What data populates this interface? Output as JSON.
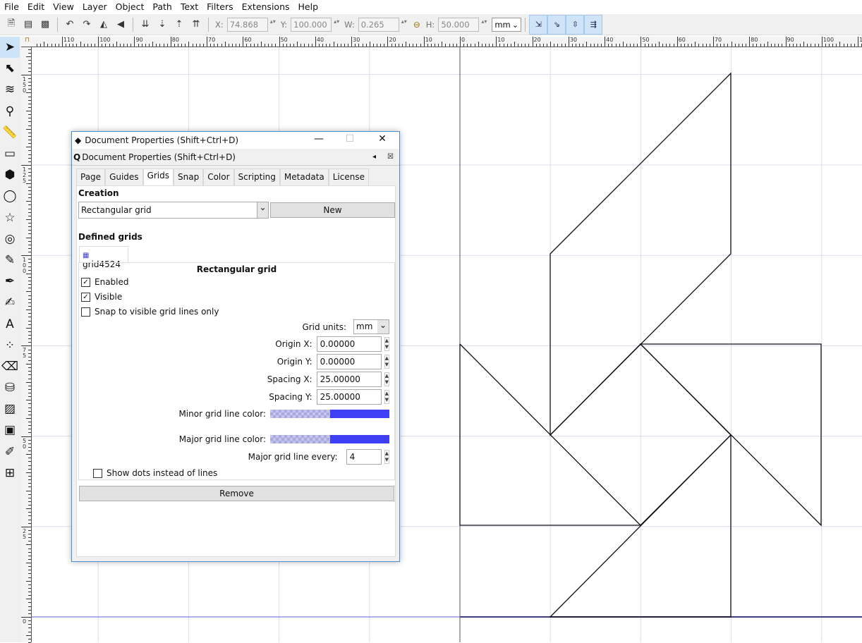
{
  "menu": [
    "File",
    "Edit",
    "View",
    "Layer",
    "Object",
    "Path",
    "Text",
    "Filters",
    "Extensions",
    "Help"
  ],
  "toolbar": {
    "x_label": "X:",
    "x": "74.868",
    "y_label": "Y:",
    "y": "100.000",
    "w_label": "W:",
    "w": "0.265",
    "h_label": "H:",
    "h": "50.000",
    "units": "mm",
    "icons": [
      "new-doc-icon",
      "select-all-icon",
      "select-all-layers-icon",
      "rotate-ccw-icon",
      "rotate-cw-icon",
      "flip-h-icon",
      "flip-v-icon",
      "lower-bottom-icon",
      "lower-icon",
      "raise-icon",
      "raise-top-icon"
    ]
  },
  "toolbox": [
    "selector",
    "node",
    "tweak",
    "zoom",
    "measure",
    "rectangle",
    "3d-box",
    "ellipse",
    "star",
    "spiral",
    "pencil",
    "pen",
    "calligraphy",
    "text",
    "spray",
    "eraser",
    "bucket",
    "gradient",
    "mesh",
    "dropper",
    "connector"
  ],
  "rulers": {
    "h_left": [
      "110",
      "100",
      "90",
      "80",
      "70",
      "60",
      "50",
      "40",
      "30",
      "20",
      "10"
    ],
    "h_right": [
      "0",
      "10",
      "20",
      "30",
      "40",
      "50",
      "60",
      "70",
      "80",
      "90",
      "100",
      "110"
    ],
    "v": [
      "150",
      "125",
      "100",
      "75",
      "50",
      "25",
      "0"
    ]
  },
  "dialog": {
    "window_title": "Document Properties (Shift+Ctrl+D)",
    "dock_title": "Document Properties (Shift+Ctrl+D)",
    "tabs": [
      "Page",
      "Guides",
      "Grids",
      "Snap",
      "Color",
      "Scripting",
      "Metadata",
      "License"
    ],
    "active_tab": "Grids",
    "creation_label": "Creation",
    "grid_type": "Rectangular grid",
    "new_label": "New",
    "defined_label": "Defined grids",
    "grid_tab": "grid4524",
    "section_title": "Rectangular grid",
    "enabled": {
      "label": "Enabled",
      "checked": true
    },
    "visible": {
      "label": "Visible",
      "checked": true
    },
    "snap_visible": {
      "label": "Snap to visible grid lines only",
      "checked": false
    },
    "grid_units_label": "Grid units:",
    "grid_units": "mm",
    "origin_x_label": "Origin X:",
    "origin_x": "0.00000",
    "origin_y_label": "Origin Y:",
    "origin_y": "0.00000",
    "spacing_x_label": "Spacing X:",
    "spacing_x": "25.00000",
    "spacing_y_label": "Spacing Y:",
    "spacing_y": "25.00000",
    "minor_color_label": "Minor grid line color:",
    "minor_color": "#3f3ff5",
    "major_color_label": "Major grid line color:",
    "major_color": "#3f3ff5",
    "major_every_label": "Major grid line every:",
    "major_every": "4",
    "show_dots": {
      "label": "Show dots instead of lines",
      "checked": false
    },
    "remove_label": "Remove"
  }
}
